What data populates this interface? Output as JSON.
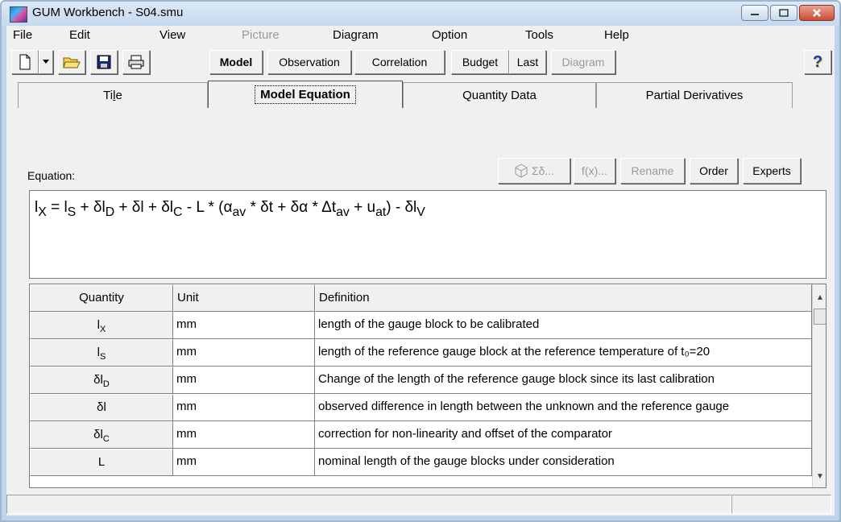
{
  "window": {
    "title": "GUM Workbench - S04.smu"
  },
  "menu": [
    "File",
    "Edit",
    "View",
    "Picture",
    "Diagram",
    "Option",
    "Tools",
    "Help"
  ],
  "menu_disabled": [
    "Picture"
  ],
  "toolbar": {
    "model": "Model",
    "observation": "Observation",
    "correlation": "Correlation",
    "budget": "Budget",
    "last": "Last",
    "diagram": "Diagram",
    "help": "?"
  },
  "tabs": {
    "title": "Title",
    "title_ul": "l",
    "model_equation": "Model Equation",
    "quantity_data": "Quantity Data",
    "partial_derivatives": "Partial Derivatives"
  },
  "equation_panel": {
    "label": "Equation:",
    "sigma_button": "Σδ...",
    "fx_button": "f(x)...",
    "rename_button": "Rename",
    "order_button": "Order",
    "experts_button": "Experts"
  },
  "table": {
    "headers": {
      "quantity": "Quantity",
      "unit": "Unit",
      "definition": "Definition"
    },
    "rows": [
      {
        "base": "l",
        "sub": "X",
        "unit": "mm",
        "definition": "length of the gauge block to be calibrated"
      },
      {
        "base": "l",
        "sub": "S",
        "unit": "mm",
        "definition": "length of the reference gauge block at the reference temperature of t₀=20"
      },
      {
        "base": "δl",
        "sub": "D",
        "unit": "mm",
        "definition": "Change of the length of the reference gauge block since its last calibration"
      },
      {
        "base": "δl",
        "sub": "",
        "unit": "mm",
        "definition": "observed difference in length between the unknown and the reference gauge"
      },
      {
        "base": "δl",
        "sub": "C",
        "unit": "mm",
        "definition": "correction for non-linearity and offset of the comparator"
      },
      {
        "base": "L",
        "sub": "",
        "unit": "mm",
        "definition": "nominal length of the gauge blocks under consideration"
      }
    ]
  }
}
